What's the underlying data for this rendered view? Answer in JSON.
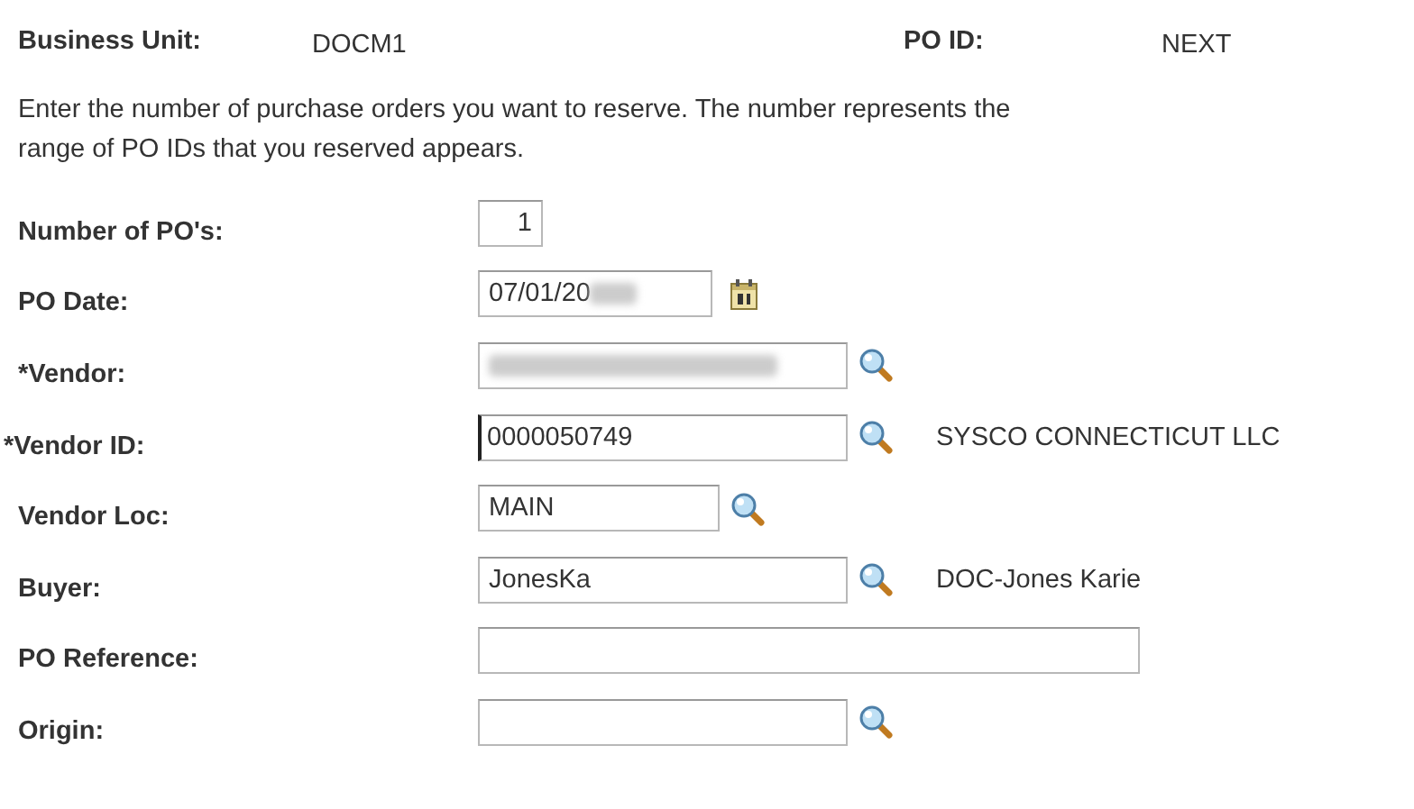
{
  "header": [
    {
      "label": "Business Unit:",
      "value": "DOCM1"
    },
    {
      "label": "PO ID:",
      "value": "NEXT"
    }
  ],
  "instructions": [
    "Enter the number of purchase orders you want to reserve. The number represents the",
    "range of PO IDs that you reserved appears."
  ],
  "fields": [
    {
      "label": "Number of PO's:",
      "kind": "number",
      "value": "1"
    },
    {
      "label": "PO Date:",
      "kind": "date",
      "value": "07/01/20",
      "redacted": true
    },
    {
      "label": "*Vendor:",
      "kind": "lookup",
      "redacted": true
    },
    {
      "label": "*Vendor ID:",
      "kind": "lookup",
      "value": "0000050749",
      "description": "SYSCO CONNECTICUT LLC",
      "focused": true
    },
    {
      "label": "Vendor Loc:",
      "kind": "lookup",
      "value": "MAIN"
    },
    {
      "label": "Buyer:",
      "kind": "lookup",
      "value": "JonesKa",
      "description": "DOC-Jones Karie"
    },
    {
      "label": "PO Reference:",
      "kind": "text"
    },
    {
      "label": "Origin:",
      "kind": "lookup"
    }
  ]
}
